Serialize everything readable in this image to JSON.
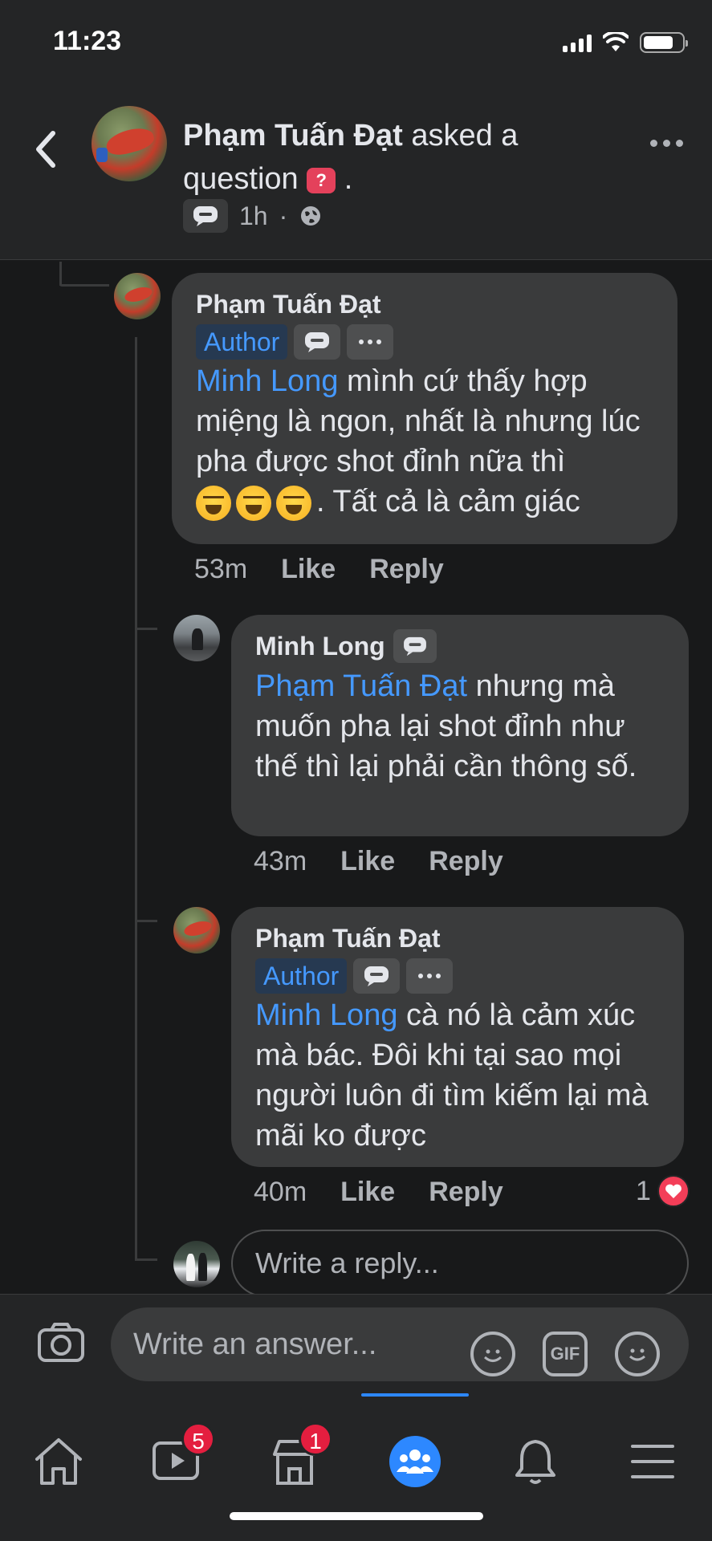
{
  "status": {
    "time": "11:23"
  },
  "header": {
    "author": "Phạm Tuấn Đạt",
    "action": "asked a question",
    "post_type_badge": "?",
    "time": "1h",
    "privacy_icon": "globe-icon"
  },
  "comments": [
    {
      "author": "Phạm Tuấn Đạt",
      "tag": "Author",
      "mention": "Minh Long",
      "text_before_emoji": " mình cứ thấy hợp miệng là ngon, nhất là nhưng lúc pha được shot đỉnh nữa thì",
      "text_after_emoji": ". Tất cả là cảm giác",
      "emoji": "laughing-emoji",
      "time": "53m",
      "like": "Like",
      "reply": "Reply"
    },
    {
      "author": "Minh Long",
      "mention": "Phạm Tuấn Đạt",
      "text": "  nhưng mà muốn pha lại shot đỉnh như thế thì lại phải cần thông số.",
      "time": "43m",
      "like": "Like",
      "reply": "Reply"
    },
    {
      "author": "Phạm Tuấn Đạt",
      "tag": "Author",
      "mention": "Minh Long",
      "text": " cà nó là cảm xúc mà bác. Đôi khi tại sao mọi người luôn đi tìm kiếm lại mà mãi ko được",
      "time": "40m",
      "like": "Like",
      "reply": "Reply",
      "reactions": "1"
    }
  ],
  "reply_box": {
    "placeholder": "Write a reply..."
  },
  "composer": {
    "placeholder": "Write an answer...",
    "gif_label": "GIF"
  },
  "tabs": {
    "watch_badge": "5",
    "marketplace_badge": "1",
    "active": "groups"
  },
  "colors": {
    "accent": "#2d88ff",
    "mention": "#4599ff",
    "badge": "#e41e3f",
    "heart": "#f33e58"
  }
}
